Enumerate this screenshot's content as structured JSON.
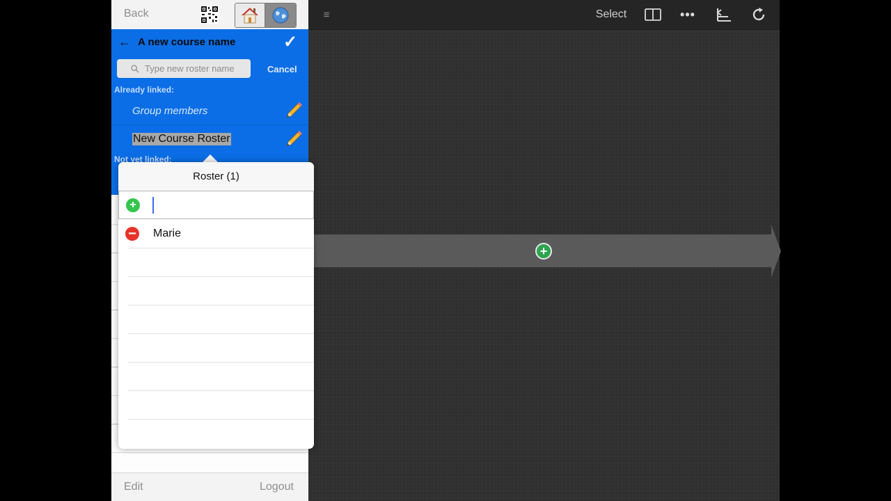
{
  "panel": {
    "nav": {
      "back_label": "Back"
    },
    "header": {
      "back_arrow": "←",
      "title": "A new course name",
      "confirm": "✓"
    },
    "search": {
      "placeholder": "Type new roster name",
      "cancel_label": "Cancel"
    },
    "already_linked_label": "Already linked:",
    "linked_items": [
      {
        "label": "Group members"
      },
      {
        "label": "New Course Roster"
      }
    ],
    "not_yet_linked_label": "Not yet linked:",
    "footer": {
      "edit_label": "Edit",
      "logout_label": "Logout"
    }
  },
  "popover": {
    "title": "Roster (1)",
    "new_entry_value": "",
    "entries": [
      {
        "name": "Marie"
      }
    ]
  },
  "toolbar": {
    "menu_icon": "≡",
    "select_label": "Select",
    "more_icon": "•••"
  },
  "icons": {
    "qr": "qr-code-icon",
    "home": "home-icon",
    "globe": "globe-icon",
    "search": "search-icon",
    "pencil": "pencil-icon",
    "split": "split-view-icon",
    "timeline": "timeline-icon",
    "refresh": "refresh-icon",
    "add": "plus-circle-icon",
    "remove": "minus-circle-icon"
  },
  "colors": {
    "accent_blue": "#0b6ee6",
    "add_green": "#35c44d",
    "remove_red": "#e8332a",
    "canvas": "#2f2f2f"
  }
}
